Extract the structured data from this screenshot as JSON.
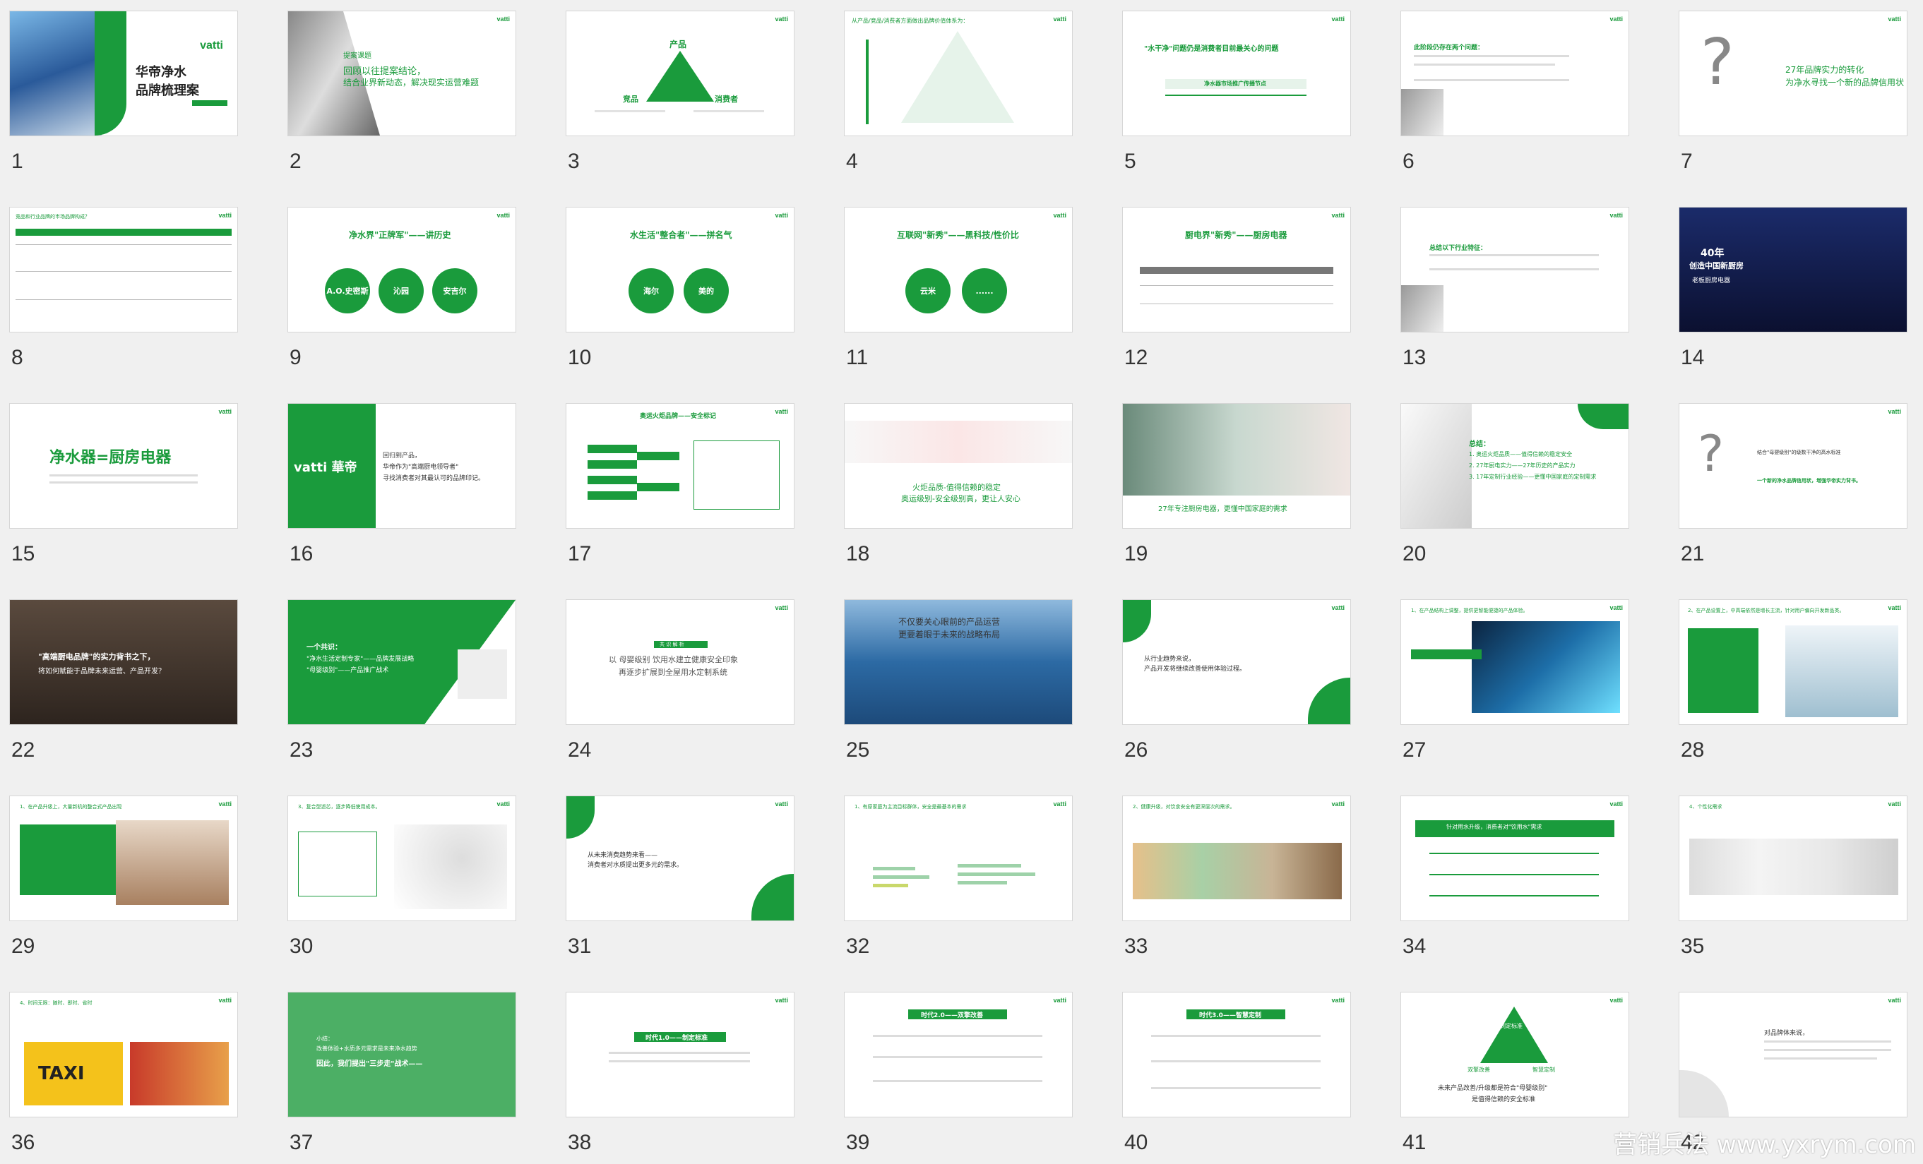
{
  "colors": {
    "brand": "#1a9b3c",
    "background": "#f0f0f0"
  },
  "logo": "vatti",
  "s1": {
    "title1": "华帝净水",
    "title2": "品牌梳理案",
    "num": "1"
  },
  "s2": {
    "tag": "提案课题",
    "l1": "回顾以往提案结论，",
    "l2": "结合业界新动态，解决现实运营难题",
    "num": "2"
  },
  "s3": {
    "top": "产品",
    "left": "竞品",
    "right": "消费者",
    "num": "3"
  },
  "s4": {
    "title": "从产品/竞品/消费者方面做出品牌价值体系为：",
    "num": "4"
  },
  "s5": {
    "title": "\"水干净\"问题仍是消费者目前最关心的问题",
    "band": "净水器市场推广传播节点",
    "num": "5"
  },
  "s6": {
    "title": "此阶段仍存在两个问题：",
    "num": "6"
  },
  "s7": {
    "q": "?",
    "l1": "27年品牌实力的转化",
    "l2": "为净水寻找一个新的品牌信用状",
    "num": "7"
  },
  "s8": {
    "title": "竞品和行业品牌的市场品牌构成？",
    "num": "8"
  },
  "s9": {
    "title": "净水界\"正牌军\"——讲历史",
    "c1": "A.O.史密斯",
    "c2": "沁园",
    "c3": "安吉尔",
    "num": "9"
  },
  "s10": {
    "title": "水生活\"整合者\"——拼名气",
    "c1": "海尔",
    "c2": "美的",
    "num": "10"
  },
  "s11": {
    "title": "互联网\"新秀\"——黑科技/性价比",
    "c1": "云米",
    "c2": "......",
    "num": "11"
  },
  "s12": {
    "title": "厨电界\"新秀\"——厨房电器",
    "num": "12"
  },
  "s13": {
    "title": "总结以下行业特征：",
    "num": "13"
  },
  "s14": {
    "l1": "40年",
    "l2": "创造中国新厨房",
    "l3": "老板厨房电器",
    "num": "14"
  },
  "s15": {
    "title": "净水器=厨房电器",
    "num": "15"
  },
  "s16": {
    "brand": "vatti 華帝",
    "l1": "回归到产品，",
    "l2": "华帝作为\"高端厨电领导者\"",
    "l3": "寻找消费者对其最认可的品牌印记。",
    "num": "16"
  },
  "s17": {
    "title": "奥运火炬品牌——安全标记",
    "num": "17"
  },
  "s18": {
    "l1": "火炬品质-值得信赖的稳定",
    "l2": "奥运级别-安全级别高，更让人安心",
    "num": "18"
  },
  "s19": {
    "l1": "27年专注厨房电器，更懂中国家庭的需求",
    "num": "19"
  },
  "s20": {
    "title": "总结：",
    "l1": "1. 奥运火炬品质——值得信赖的稳定安全",
    "l2": "2. 27年厨电实力——27年历史的产品实力",
    "l3": "3. 17年定制行业经验——更懂中国家庭的定制需求",
    "num": "20"
  },
  "s21": {
    "q": "?",
    "l1": "结合\"母婴级别\"的级数干净的高水标准",
    "l2": "一个新的净水品牌信用状，增强华帝实力背书。",
    "num": "21"
  },
  "s22": {
    "l1": "\"高端厨电品牌\"的实力背书之下，",
    "l2": "将如何赋能于品牌未来运营、产品开发？",
    "num": "22"
  },
  "s23": {
    "l1": "一个共识：",
    "l2": "\"净水生活定制专家\"——品牌发展战略",
    "l3": "\"母婴级别\"——产品推广战术",
    "num": "23"
  },
  "s24": {
    "tag": "共 识 解 析",
    "l1": "以 母婴级别 饮用水建立健康安全印象",
    "l2": "再逐步扩展到全屋用水定制系统",
    "num": "24"
  },
  "s25": {
    "l1": "不仅要关心眼前的产品运营",
    "l2": "更要着眼于未来的战略布局",
    "num": "25"
  },
  "s26": {
    "l1": "从行业趋势来说，",
    "l2": "产品开发将继续改善使用体验过程。",
    "num": "26"
  },
  "s27": {
    "title": "1、在产品结构上调整，提供更智能便捷的产品体验。",
    "num": "27"
  },
  "s28": {
    "title": "2、在产品设置上，中高端依然是增长主流，针对用户偏向开发新品类。",
    "num": "28"
  },
  "s29": {
    "title": "1、在产品升级上，大量新机的整合式产品出现",
    "num": "29"
  },
  "s30": {
    "title": "3、复合型滤芯，逐步降低使用成本。",
    "num": "30"
  },
  "s31": {
    "l1": "从未来消费趋势来看——",
    "l2": "消费者对水质提出更多元的需求。",
    "num": "31"
  },
  "s32": {
    "title": "1、有原家庭为主流目标群体，安全是最基本的需求",
    "num": "32"
  },
  "s33": {
    "title": "2、健康升级，对饮食安全有更深层次的需求。",
    "num": "33"
  },
  "s34": {
    "title": "针对用水升级，消费者对\"饮用水\"需求",
    "num": "34"
  },
  "s35": {
    "title": "4、个性化需求",
    "num": "35"
  },
  "s36": {
    "title": "4、时间无限：随时、即时、省时",
    "taxi": "TAXI",
    "num": "36"
  },
  "s37": {
    "l1": "小结：",
    "l2": "改善体验+水质多元需求是未来净水趋势",
    "l3": "因此，我们提出\"三步走\"战术——",
    "num": "37"
  },
  "s38": {
    "title": "时代1.0——制定标准",
    "num": "38"
  },
  "s39": {
    "title": "时代2.0——双擎改善",
    "num": "39"
  },
  "s40": {
    "title": "时代3.0——智慧定制",
    "num": "40"
  },
  "s41": {
    "top": "制定标准",
    "left": "双擎改善",
    "right": "智慧定制",
    "l1": "未来产品改善/升级都是符合\"母婴级别\"",
    "l2": "是值得信赖的安全标准",
    "num": "41"
  },
  "s42": {
    "l1": "对品牌体来说，",
    "num": "42"
  },
  "watermark": "营销兵法 www.yxrym.com"
}
